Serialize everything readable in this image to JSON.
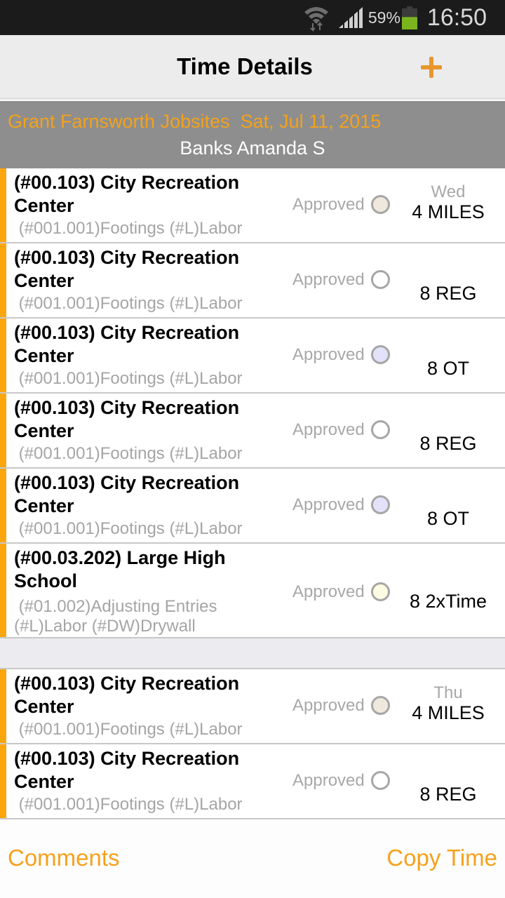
{
  "status_bar": {
    "battery_percent": "59%",
    "battery_level": 0.59,
    "time": "16:50",
    "icons": [
      "wifi-icon",
      "signal-icon",
      "battery-icon"
    ]
  },
  "action_bar": {
    "title": "Time Details",
    "add_icon": "plus-icon",
    "accent_color": "#e8962d"
  },
  "header": {
    "company_date": "Grant Farnsworth Jobsites  Sat, Jul 11, 2015",
    "employee": "Banks Amanda S"
  },
  "groups": [
    {
      "entries": [
        {
          "job": "(#00.103) City Recreation Center",
          "cost": " (#001.001)Footings (#L)Labor",
          "status": "Approved",
          "circle_color": "#efe8dc",
          "day": "Wed",
          "quantity": "4 MILES"
        },
        {
          "job": "(#00.103) City Recreation Center",
          "cost": " (#001.001)Footings (#L)Labor",
          "status": "Approved",
          "circle_color": "#ffffff",
          "day": "",
          "quantity": "8 REG"
        },
        {
          "job": "(#00.103) City Recreation Center",
          "cost": " (#001.001)Footings (#L)Labor",
          "status": "Approved",
          "circle_color": "#e2e2fa",
          "day": "",
          "quantity": "8 OT"
        },
        {
          "job": "(#00.103) City Recreation Center",
          "cost": " (#001.001)Footings (#L)Labor",
          "status": "Approved",
          "circle_color": "#ffffff",
          "day": "",
          "quantity": "8 REG"
        },
        {
          "job": "(#00.103) City Recreation Center",
          "cost": " (#001.001)Footings (#L)Labor",
          "status": "Approved",
          "circle_color": "#e2e2fa",
          "day": "",
          "quantity": "8 OT"
        },
        {
          "job": "(#00.03.202) Large High School",
          "cost": " (#01.002)Adjusting Entries\n(#L)Labor (#DW)Drywall",
          "status": "Approved",
          "circle_color": "#fdfbe2",
          "day": "",
          "quantity": "8 2xTime"
        }
      ]
    },
    {
      "entries": [
        {
          "job": "(#00.103) City Recreation Center",
          "cost": " (#001.001)Footings (#L)Labor",
          "status": "Approved",
          "circle_color": "#efe8dc",
          "day": "Thu",
          "quantity": "4 MILES"
        },
        {
          "job": "(#00.103) City Recreation Center",
          "cost": " (#001.001)Footings (#L)Labor",
          "status": "Approved",
          "circle_color": "#ffffff",
          "day": "",
          "quantity": "8 REG"
        }
      ]
    }
  ],
  "footer": {
    "comments_label": "Comments",
    "copy_time_label": "Copy Time"
  }
}
